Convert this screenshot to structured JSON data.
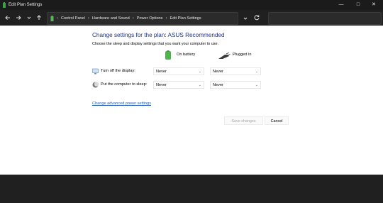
{
  "window": {
    "title": "Edit Plan Settings",
    "minimize": "—",
    "maximize": "□",
    "close": "✕"
  },
  "address_bar": {
    "breadcrumbs": [
      "Control Panel",
      "Hardware and Sound",
      "Power Options",
      "Edit Plan Settings"
    ]
  },
  "main": {
    "heading": "Change settings for the plan: ASUS Recommended",
    "subtitle": "Choose the sleep and display settings that you want your computer to use.",
    "columns": {
      "on_battery": "On battery",
      "plugged_in": "Plugged in"
    },
    "settings": [
      {
        "label": "Turn off the display:",
        "on_battery": "Never",
        "plugged_in": "Never"
      },
      {
        "label": "Put the computer to sleep:",
        "on_battery": "Never",
        "plugged_in": "Never"
      }
    ],
    "advanced_link": "Change advanced power settings",
    "save_label": "Save changes",
    "cancel_label": "Cancel"
  },
  "colors": {
    "heading": "#1e3287",
    "link": "#2a62b8",
    "chrome": "#202020"
  }
}
